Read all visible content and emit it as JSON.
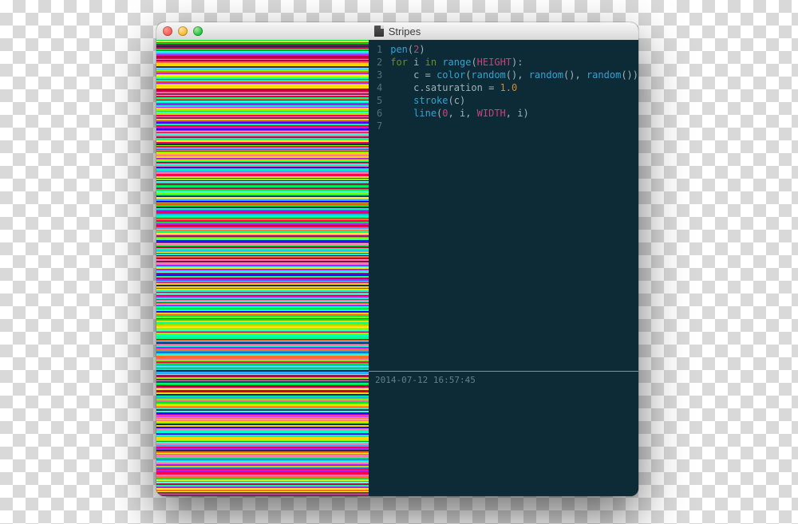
{
  "window": {
    "title": "Stripes"
  },
  "code": {
    "line_numbers": [
      "1",
      "2",
      "3",
      "4",
      "5",
      "6",
      "7"
    ],
    "lines": [
      {
        "tokens": [
          {
            "t": "pen",
            "c": "fn"
          },
          {
            "t": "(",
            "c": "pun"
          },
          {
            "t": "2",
            "c": "num"
          },
          {
            "t": ")",
            "c": "pun"
          }
        ]
      },
      {
        "tokens": [
          {
            "t": "for",
            "c": "kw"
          },
          {
            "t": " ",
            "c": "id"
          },
          {
            "t": "i",
            "c": "id"
          },
          {
            "t": " ",
            "c": "id"
          },
          {
            "t": "in",
            "c": "kw"
          },
          {
            "t": " ",
            "c": "id"
          },
          {
            "t": "range",
            "c": "fn"
          },
          {
            "t": "(",
            "c": "pun"
          },
          {
            "t": "HEIGHT",
            "c": "spec"
          },
          {
            "t": "):",
            "c": "pun"
          }
        ]
      },
      {
        "tokens": [
          {
            "t": "    ",
            "c": "id"
          },
          {
            "t": "c",
            "c": "id"
          },
          {
            "t": " = ",
            "c": "pun"
          },
          {
            "t": "color",
            "c": "fn"
          },
          {
            "t": "(",
            "c": "pun"
          },
          {
            "t": "random",
            "c": "fn"
          },
          {
            "t": "()",
            "c": "pun"
          },
          {
            "t": ", ",
            "c": "pun"
          },
          {
            "t": "random",
            "c": "fn"
          },
          {
            "t": "()",
            "c": "pun"
          },
          {
            "t": ", ",
            "c": "pun"
          },
          {
            "t": "random",
            "c": "fn"
          },
          {
            "t": "())",
            "c": "pun"
          }
        ]
      },
      {
        "tokens": [
          {
            "t": "    ",
            "c": "id"
          },
          {
            "t": "c",
            "c": "id"
          },
          {
            "t": ".",
            "c": "dot"
          },
          {
            "t": "saturation",
            "c": "id"
          },
          {
            "t": " = ",
            "c": "pun"
          },
          {
            "t": "1.0",
            "c": "numorange"
          }
        ]
      },
      {
        "tokens": [
          {
            "t": "    ",
            "c": "id"
          },
          {
            "t": "stroke",
            "c": "fn"
          },
          {
            "t": "(",
            "c": "pun"
          },
          {
            "t": "c",
            "c": "id"
          },
          {
            "t": ")",
            "c": "pun"
          }
        ]
      },
      {
        "tokens": [
          {
            "t": "    ",
            "c": "id"
          },
          {
            "t": "line",
            "c": "fn"
          },
          {
            "t": "(",
            "c": "pun"
          },
          {
            "t": "0",
            "c": "num"
          },
          {
            "t": ", ",
            "c": "pun"
          },
          {
            "t": "i",
            "c": "id"
          },
          {
            "t": ", ",
            "c": "pun"
          },
          {
            "t": "WIDTH",
            "c": "spec"
          },
          {
            "t": ", ",
            "c": "pun"
          },
          {
            "t": "i",
            "c": "id"
          },
          {
            "t": ")",
            "c": "pun"
          }
        ]
      },
      {
        "tokens": []
      }
    ]
  },
  "status": {
    "timestamp": "2014-07-12 16:57:45"
  },
  "canvas": {
    "palette": [
      "#ff004d",
      "#00e436",
      "#29adff",
      "#ffec27",
      "#ab23ff",
      "#00ffcc",
      "#ff6c24",
      "#1d2b53",
      "#ff77a8",
      "#83ff00",
      "#2200ff",
      "#ffd500",
      "#00ff92",
      "#c2003f",
      "#2effd6",
      "#7e2553"
    ]
  }
}
